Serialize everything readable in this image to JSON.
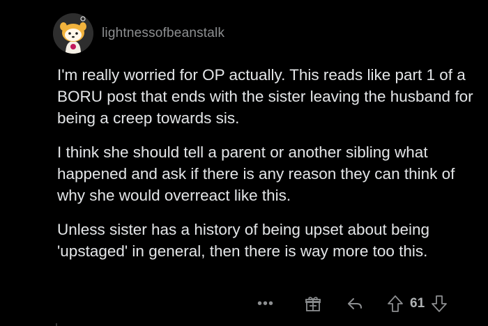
{
  "comment": {
    "username": "lightnessofbeanstalk",
    "paragraphs": [
      "I'm really worried for OP actually. This reads like part 1 of a BORU post that ends with the sister leaving the husband for being a creep towards sis.",
      "I think she should tell a parent or another sibling what happened and ask if there is any reason they can think of why she would overreact like this.",
      "Unless sister has a history of being upset about being 'upstaged' in general, then there is way more too this."
    ],
    "actions": {
      "more_label": "•••",
      "score": "61"
    }
  },
  "icons": {
    "avatar": "snoo-avatar-icon",
    "more": "more-options-icon",
    "award": "award-gift-icon",
    "reply": "reply-arrow-icon",
    "upvote": "upvote-arrow-icon",
    "downvote": "downvote-arrow-icon"
  },
  "colors": {
    "background": "#000000",
    "text": "#e4e6e8",
    "muted": "#8d8f91"
  }
}
